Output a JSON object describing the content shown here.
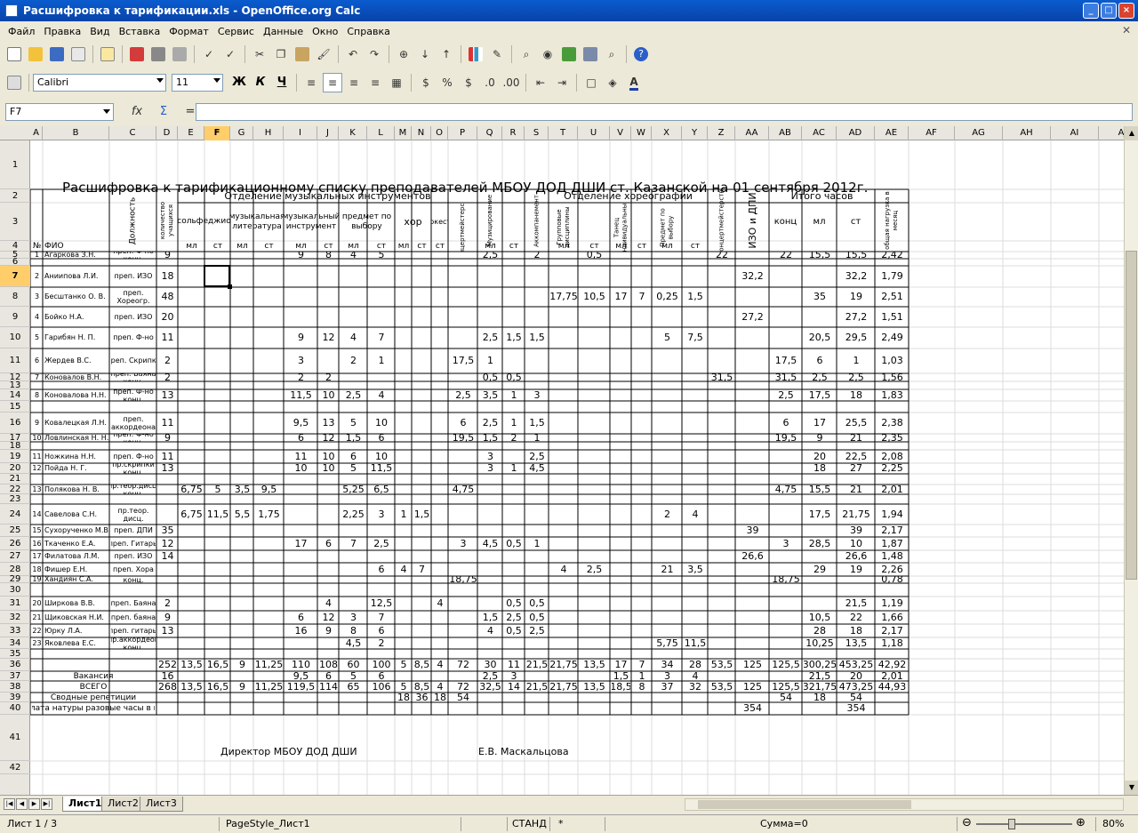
{
  "window": {
    "title": "Расшифровка к тарификации.xls - OpenOffice.org Calc"
  },
  "menu": [
    "Файл",
    "Правка",
    "Вид",
    "Вставка",
    "Формат",
    "Сервис",
    "Данные",
    "Окно",
    "Справка"
  ],
  "format_toolbar": {
    "font_name": "Calibri",
    "font_size": "11",
    "bold": "Ж",
    "italic": "К",
    "underline": "Ч"
  },
  "formula_bar": {
    "name_box": "F7",
    "fx": "fx",
    "sum": "Σ",
    "equals": "=",
    "content": ""
  },
  "colors": {
    "selection": "#ffce6b",
    "title_bar": "#0a5ccf",
    "grid": "#d0d0d0",
    "border": "#000000"
  },
  "column_headers": [
    "A",
    "B",
    "C",
    "D",
    "E",
    "F",
    "G",
    "H",
    "I",
    "J",
    "K",
    "L",
    "M",
    "N",
    "O",
    "P",
    "Q",
    "R",
    "S",
    "T",
    "U",
    "V",
    "W",
    "X",
    "Y",
    "Z",
    "AA",
    "AB",
    "AC",
    "AD",
    "AE",
    "AF",
    "AG",
    "AH",
    "AI",
    "AJ"
  ],
  "row_headers": [
    "1",
    "2",
    "3",
    "4",
    "5",
    "6",
    "7",
    "8",
    "9",
    "10",
    "11",
    "12",
    "13",
    "14",
    "15",
    "16",
    "17",
    "18",
    "19",
    "20",
    "21",
    "22",
    "23",
    "24",
    "25",
    "26",
    "27",
    "28",
    "29",
    "30",
    "31",
    "32",
    "33",
    "34",
    "35",
    "36",
    "37",
    "38",
    "39",
    "40",
    "41",
    "42"
  ],
  "selected_cell": "F7",
  "chart_data": {
    "type": "table",
    "title": "Расшифровка  к тарификационному списку преподавателей МБОУ ДОД ДШИ ст. Казанской на  01 сентября 2012г.",
    "groups": {
      "music": "Отделение музыкальных инструментов",
      "choreo": "Отделение хореографии",
      "total_hours": "Итого часов"
    },
    "header": {
      "num": "№",
      "fio": "ФИО",
      "position": "Должность",
      "students": "количество учащихся",
      "solfeggio": "сольфеджио",
      "music_lit": "музыкальная литература",
      "music_instr": "музыкальный инструмент",
      "elective": "предмет по выбору",
      "choir": "хор",
      "orchestra": "Оркестр",
      "concertmaster": "Концертмейстерство",
      "music_making": "Музицирование",
      "accompaniment": "Аккомпанемент",
      "group_disc": "Групповые дисциплины",
      "dance_individ": "Танец индивидуальный",
      "elective2": "Предмет по выбору",
      "concertmaster2": "Концертмейстерство",
      "izo": "ИЗО и ДПИ",
      "konc": "конц",
      "ml": "мл",
      "st": "ст",
      "monthly": "общая нагрузка в месяц"
    },
    "rows": [
      {
        "r": 5,
        "num": "1",
        "fio": "Агаркова З.Н.",
        "pos": [
          "преп. Ф-но",
          "конц."
        ],
        "vals": {
          "D": "9",
          "I": "9",
          "J": "8",
          "K": "4",
          "L": "5",
          "Q": "2,5",
          "S": "2",
          "U": "0,5",
          "Z": "22",
          "AB": "22",
          "AC": "15,5",
          "AD": "15,5",
          "AE": "2,42"
        }
      },
      {
        "r": 7,
        "num": "2",
        "fio": "Аниипова Л.И.",
        "pos": [
          "преп. ИЗО"
        ],
        "vals": {
          "D": "18",
          "AA": "32,2",
          "AD": "32,2",
          "AE": "1,79"
        }
      },
      {
        "r": 8,
        "num": "3",
        "fio": "Бесштанко О. В.",
        "pos": [
          "преп.",
          "Хореогр."
        ],
        "vals": {
          "D": "48",
          "T": "17,75",
          "U": "10,5",
          "V": "17",
          "W": "7",
          "X": "0,25",
          "Y": "1,5",
          "AC": "35",
          "AD": "19",
          "AE": "2,51"
        }
      },
      {
        "r": 9,
        "num": "4",
        "fio": "Бойко Н.А.",
        "pos": [
          "преп. ИЗО"
        ],
        "vals": {
          "D": "20",
          "AA": "27,2",
          "AD": "27,2",
          "AE": "1,51"
        }
      },
      {
        "r": 10,
        "num": "5",
        "fio": "Гарибян Н. П.",
        "pos": [
          "преп. Ф-но"
        ],
        "vals": {
          "D": "11",
          "I": "9",
          "J": "12",
          "K": "4",
          "L": "7",
          "Q": "2,5",
          "R": "1,5",
          "S": "1,5",
          "X": "5",
          "Y": "7,5",
          "AC": "20,5",
          "AD": "29,5",
          "AE": "2,49"
        }
      },
      {
        "r": 11,
        "num": "6",
        "fio": "Жердев В.С.",
        "pos": [
          "преп. Скрипка"
        ],
        "vals": {
          "D": "2",
          "I": "3",
          "K": "2",
          "L": "1",
          "P": "17,5",
          "Q": "1",
          "AB": "17,5",
          "AC": "6",
          "AD": "1",
          "AE": "1,03"
        }
      },
      {
        "r": 12,
        "num": "7",
        "fio": "Коновалов В.Н.",
        "pos": [
          "преп. Баяна",
          "конц."
        ],
        "vals": {
          "D": "2",
          "I": "2",
          "J": "2",
          "Q": "0,5",
          "R": "0,5",
          "Z": "31,5",
          "AB": "31,5",
          "AC": "2,5",
          "AD": "2,5",
          "AE": "1,56"
        }
      },
      {
        "r": 14,
        "num": "8",
        "fio": "Коновалова Н.Н.",
        "pos": [
          "преп. Ф-но",
          "конц."
        ],
        "vals": {
          "D": "13",
          "I": "11,5",
          "J": "10",
          "K": "2,5",
          "L": "4",
          "P": "2,5",
          "Q": "3,5",
          "R": "1",
          "S": "3",
          "AB": "2,5",
          "AC": "17,5",
          "AD": "18",
          "AE": "1,83"
        }
      },
      {
        "r": 16,
        "num": "9",
        "fio": "Ковалецкая Л.Н.",
        "pos": [
          "преп.",
          "аккордеона"
        ],
        "vals": {
          "D": "11",
          "I": "9,5",
          "J": "13",
          "K": "5",
          "L": "10",
          "P": "6",
          "Q": "2,5",
          "R": "1",
          "S": "1,5",
          "AB": "6",
          "AC": "17",
          "AD": "25,5",
          "AE": "2,38"
        }
      },
      {
        "r": 17,
        "num": "10",
        "fio": "Ловлинская Н. Н.",
        "pos": [
          "преп. Ф-но",
          "конц."
        ],
        "vals": {
          "D": "9",
          "I": "6",
          "J": "12",
          "K": "1,5",
          "L": "6",
          "P": "19,5",
          "Q": "1,5",
          "R": "2",
          "S": "1",
          "AB": "19,5",
          "AC": "9",
          "AD": "21",
          "AE": "2,35"
        }
      },
      {
        "r": 19,
        "num": "11",
        "fio": "Ножкина Н.Н.",
        "pos": [
          "преп. Ф-но"
        ],
        "vals": {
          "D": "11",
          "I": "11",
          "J": "10",
          "K": "6",
          "L": "10",
          "Q": "3",
          "S": "2,5",
          "AC": "20",
          "AD": "22,5",
          "AE": "2,08"
        }
      },
      {
        "r": 20,
        "num": "12",
        "fio": "Пойда Н. Г.",
        "pos": [
          "пр.скрипки",
          "конц."
        ],
        "vals": {
          "D": "13",
          "I": "10",
          "J": "10",
          "K": "5",
          "L": "11,5",
          "Q": "3",
          "R": "1",
          "S": "4,5",
          "AC": "18",
          "AD": "27",
          "AE": "2,25"
        }
      },
      {
        "r": 22,
        "num": "13",
        "fio": "Полякова Н. В.",
        "pos": [
          "пр.теор.дисц.",
          "конц."
        ],
        "vals": {
          "E": "6,75",
          "F": "5",
          "G": "3,5",
          "H": "9,5",
          "K": "5,25",
          "L": "6,5",
          "P": "4,75",
          "AB": "4,75",
          "AC": "15,5",
          "AD": "21",
          "AE": "2,01"
        }
      },
      {
        "r": 24,
        "num": "14",
        "fio": "Савелова С.Н.",
        "pos": [
          "пр.теор.",
          "дисц."
        ],
        "vals": {
          "E": "6,75",
          "F": "11,5",
          "G": "5,5",
          "H": "1,75",
          "K": "2,25",
          "L": "3",
          "M": "1",
          "N": "1,5",
          "X": "2",
          "Y": "4",
          "AC": "17,5",
          "AD": "21,75",
          "AE": "1,94"
        }
      },
      {
        "r": 25,
        "num": "15",
        "fio": "Сухорученко М.В.",
        "pos": [
          "преп. ДПИ"
        ],
        "vals": {
          "D": "35",
          "AA": "39",
          "AD": "39",
          "AE": "2,17"
        }
      },
      {
        "r": 26,
        "num": "16",
        "fio": "Ткаченко Е.А.",
        "pos": [
          "преп. Гитары"
        ],
        "vals": {
          "D": "12",
          "I": "17",
          "J": "6",
          "K": "7",
          "L": "2,5",
          "P": "3",
          "Q": "4,5",
          "R": "0,5",
          "S": "1",
          "AB": "3",
          "AC": "28,5",
          "AD": "10",
          "AE": "1,87"
        }
      },
      {
        "r": 27,
        "num": "17",
        "fio": "Филатова Л.М.",
        "pos": [
          "преп. ИЗО"
        ],
        "vals": {
          "D": "14",
          "AA": "26,6",
          "AD": "26,6",
          "AE": "1,48"
        }
      },
      {
        "r": 28,
        "num": "18",
        "fio": "Фишер Е.Н.",
        "pos": [
          "преп. Хора"
        ],
        "vals": {
          "L": "6",
          "M": "4",
          "N": "7",
          "T": "4",
          "U": "2,5",
          "X": "21",
          "Y": "3,5",
          "AC": "29",
          "AD": "19",
          "AE": "2,26"
        }
      },
      {
        "r": 29,
        "num": "19",
        "fio": "Хандиян С.А.",
        "pos": [
          "",
          "конц."
        ],
        "vals": {
          "P": "18,75",
          "AB": "18,75",
          "AE": "0,78"
        }
      },
      {
        "r": 31,
        "num": "20",
        "fio": "Ширкова В.В.",
        "pos": [
          "преп. Баяна"
        ],
        "vals": {
          "D": "2",
          "J": "4",
          "L": "12,5",
          "O": "4",
          "R": "0,5",
          "S": "0,5",
          "AD": "21,5",
          "AE": "1,19"
        }
      },
      {
        "r": 32,
        "num": "21",
        "fio": "Щиковская Н.И.",
        "pos": [
          "преп. баяна"
        ],
        "vals": {
          "D": "9",
          "I": "6",
          "J": "12",
          "K": "3",
          "L": "7",
          "Q": "1,5",
          "R": "2,5",
          "S": "0,5",
          "AC": "10,5",
          "AD": "22",
          "AE": "1,66"
        }
      },
      {
        "r": 33,
        "num": "22",
        "fio": "Юрку Л.А.",
        "pos": [
          "преп. гитары"
        ],
        "vals": {
          "D": "13",
          "I": "16",
          "J": "9",
          "K": "8",
          "L": "6",
          "Q": "4",
          "R": "0,5",
          "S": "2,5",
          "AC": "28",
          "AD": "18",
          "AE": "2,17"
        }
      },
      {
        "r": 34,
        "num": "23",
        "fio": "Яковлева Е.С.",
        "pos": [
          "пр.аккордеон",
          "конц."
        ],
        "vals": {
          "K": "4,5",
          "L": "2",
          "X": "5,75",
          "Y": "11,5",
          "AC": "10,25",
          "AD": "13,5",
          "AE": "1,18"
        }
      }
    ],
    "totals": [
      {
        "r": 36,
        "label": "",
        "vals": {
          "D": "252",
          "E": "13,5",
          "F": "16,5",
          "G": "9",
          "H": "11,25",
          "I": "110",
          "J": "108",
          "K": "60",
          "L": "100",
          "M": "5",
          "N": "8,5",
          "O": "4",
          "P": "72",
          "Q": "30",
          "R": "11",
          "S": "21,5",
          "T": "21,75",
          "U": "13,5",
          "V": "17",
          "W": "7",
          "X": "34",
          "Y": "28",
          "Z": "53,5",
          "AA": "125",
          "AB": "125,5",
          "AC": "300,25",
          "AD": "453,25",
          "AE": "42,92"
        }
      },
      {
        "r": 37,
        "label": "Вакансия",
        "vals": {
          "D": "16",
          "I": "9,5",
          "J": "6",
          "K": "5",
          "L": "6",
          "Q": "2,5",
          "R": "3",
          "V": "1,5",
          "W": "1",
          "X": "3",
          "Y": "4",
          "AC": "21,5",
          "AD": "20",
          "AE": "2,01"
        }
      },
      {
        "r": 38,
        "label": "ВСЕГО",
        "vals": {
          "D": "268",
          "E": "13,5",
          "F": "16,5",
          "G": "9",
          "H": "11,25",
          "I": "119,5",
          "J": "114",
          "K": "65",
          "L": "106",
          "M": "5",
          "N": "8,5",
          "O": "4",
          "P": "72",
          "Q": "32,5",
          "R": "14",
          "S": "21,5",
          "T": "21,75",
          "U": "13,5",
          "V": "18,5",
          "W": "8",
          "X": "37",
          "Y": "32",
          "Z": "53,5",
          "AA": "125",
          "AB": "125,5",
          "AC": "321,75",
          "AD": "473,25",
          "AE": "44,93"
        }
      },
      {
        "r": 39,
        "label": "Сводные репетиции",
        "vals": {
          "M": "18",
          "N": "36",
          "O": "18",
          "P": "54",
          "AB": "54",
          "AC": "18",
          "AD": "54"
        }
      },
      {
        "r": 40,
        "label": "Оплата натуры разовые часы в год",
        "vals": {
          "AA": "354",
          "AD": "354"
        }
      }
    ],
    "footer": {
      "director": "Директор МБОУ ДОД ДШИ",
      "name": "Е.В. Маскальцова"
    }
  },
  "sheet_tabs": [
    "Лист1",
    "Лист2",
    "Лист3"
  ],
  "status": {
    "sheet": "Лист 1 / 3",
    "style": "PageStyle_Лист1",
    "mode": "СТАНД",
    "modified": "*",
    "sum": "Сумма=0",
    "zoom": "80%"
  }
}
